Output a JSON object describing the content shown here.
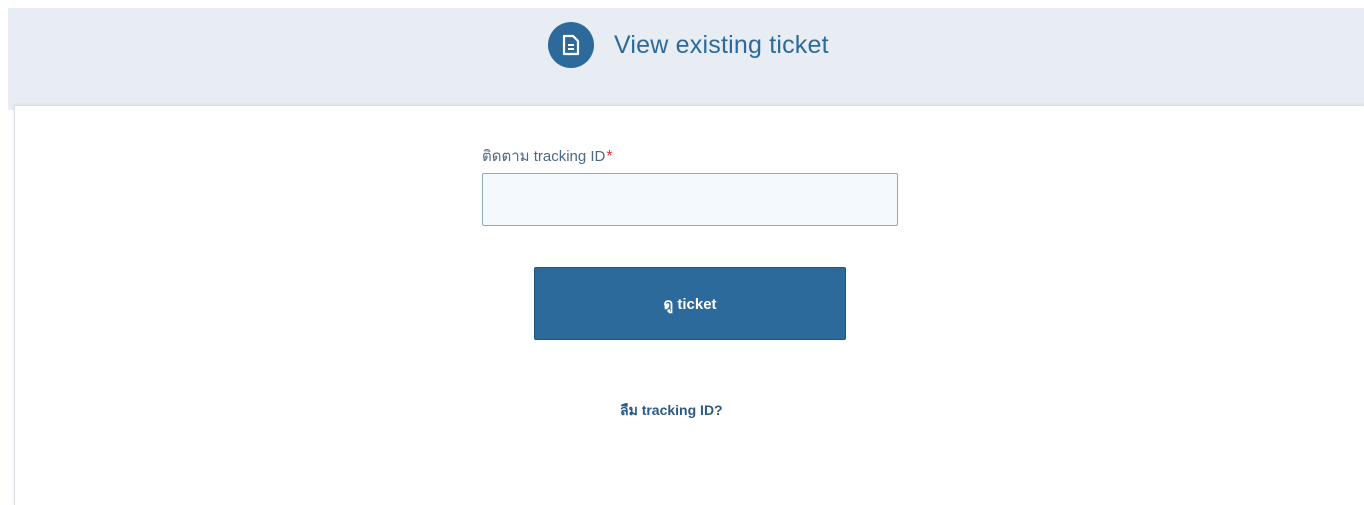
{
  "header": {
    "icon": "document-icon",
    "title": "View existing ticket"
  },
  "form": {
    "tracking_label": "ติดตาม tracking ID",
    "required_marker": "*",
    "tracking_value": "",
    "submit_label": "ดู ticket",
    "forgot_link": "ลืม tracking ID?"
  },
  "colors": {
    "accent": "#2b6a9b",
    "header_bg": "#e7edf2",
    "required": "#d8343a"
  }
}
